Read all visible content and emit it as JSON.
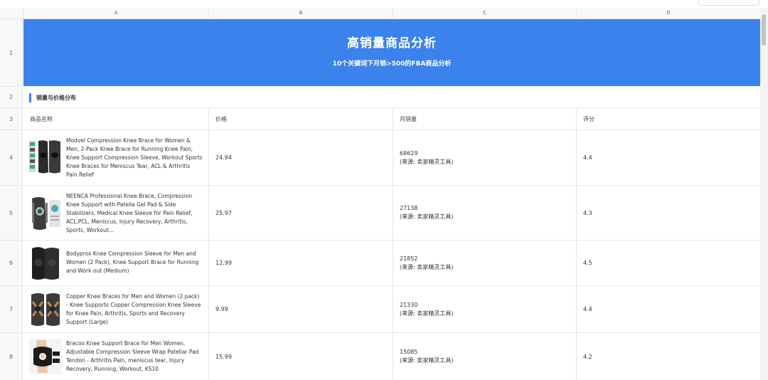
{
  "columns": [
    "A",
    "B",
    "C",
    "D"
  ],
  "rows": [
    "1",
    "2",
    "3",
    "4",
    "5",
    "6",
    "7",
    "8"
  ],
  "banner": {
    "title": "高销量商品分析",
    "subtitle": "10个关键词下月销>500的FBA商品分析"
  },
  "section_title": "销量与价格分布",
  "table": {
    "headers": [
      "商品名称",
      "价格",
      "月销量",
      "评分"
    ],
    "items": [
      {
        "name": "Modvel Compression Knee Brace for Women & Men, 2-Pack Knee Brace for Running Knee Pain, Knee Support Compression Sleeve, Workout Sports Knee Braces for Meniscus Tear, ACL & Arthritis Pain Relief",
        "price": "24.94",
        "sales": "68629",
        "source": "(来源: 卖家精灵工具)",
        "rating": "4.4",
        "thumb": "knee-sleeve-pack-icon"
      },
      {
        "name": "NEENCA Professional Knee Brace, Compression Knee Support with Patella Gel Pad & Side Stabilizers, Medical Knee Sleeve for Pain Relief, ACL,PCL, Meniscus, Injury Recovery, Arthritis, Sports, Workout...",
        "price": "25.97",
        "sales": "27138",
        "source": "(来源: 卖家精灵工具)",
        "rating": "4.3",
        "thumb": "knee-brace-gel-pad-icon"
      },
      {
        "name": "Bodyprox Knee Compression Sleeve for Men and Women (2 Pack), Knee Support Brace for Running and Work out (Medium)",
        "price": "12.99",
        "sales": "21852",
        "source": "(来源: 卖家精灵工具)",
        "rating": "4.5",
        "thumb": "black-knee-sleeve-icon"
      },
      {
        "name": "Copper Knee Braces for Men and Women (2 pack) - Knee Supports Copper Compression Knee Sleeve for Knee Pain, Arthritis, Sports and Recovery Support (Large)",
        "price": "9.99",
        "sales": "21330",
        "source": "(来源: 卖家精灵工具)",
        "rating": "4.4",
        "thumb": "copper-knee-sleeve-icon"
      },
      {
        "name": "Bracoo Knee Support Brace for Men Women, Adjustable Compression Sleeve Wrap Patellar Pad Tendon - Arthritis Pain, meniscus tear, Injury Recovery, Running, Workout, KS10",
        "price": "15.99",
        "sales": "15085",
        "source": "(来源: 卖家精灵工具)",
        "rating": "4.2",
        "thumb": "wrap-knee-support-icon"
      }
    ]
  },
  "colors": {
    "banner": "#3b82ed",
    "accent": "#3b82ed"
  }
}
